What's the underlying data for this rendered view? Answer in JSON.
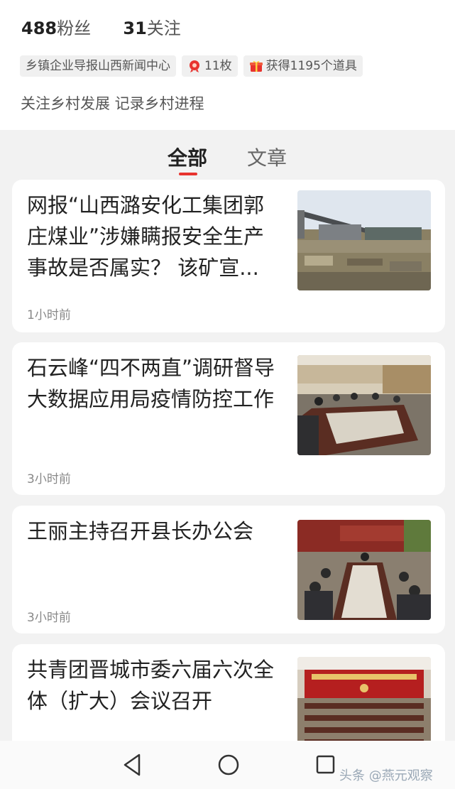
{
  "profile": {
    "fans_count": "488",
    "fans_label": "粉丝",
    "follow_count": "31",
    "follow_label": "关注",
    "tags": {
      "source": "乡镇企业导报山西新闻中心",
      "medals": "11枚",
      "props": "获得1195个道具"
    },
    "bio": "关注乡村发展 记录乡村进程"
  },
  "tabs": [
    {
      "label": "全部",
      "active": true
    },
    {
      "label": "文章",
      "active": false
    }
  ],
  "articles": [
    {
      "title": "网报“山西潞安化工集团郭庄煤业”涉嫌瞒报安全生产事故是否属实？ 该矿宣...",
      "time": "1小时前"
    },
    {
      "title": "石云峰“四不两直”调研督导大数据应用局疫情防控工作",
      "time": "3小时前"
    },
    {
      "title": "王丽主持召开县长办公会",
      "time": "3小时前"
    },
    {
      "title": "共青团晋城市委六届六次全体（扩大）会议召开",
      "time": ""
    }
  ],
  "watermark": "头条 @燕元观察",
  "colors": {
    "accent": "#e8332e",
    "background": "#f2f2f2"
  },
  "nav_icons": [
    "back-icon",
    "home-icon",
    "recents-icon"
  ]
}
